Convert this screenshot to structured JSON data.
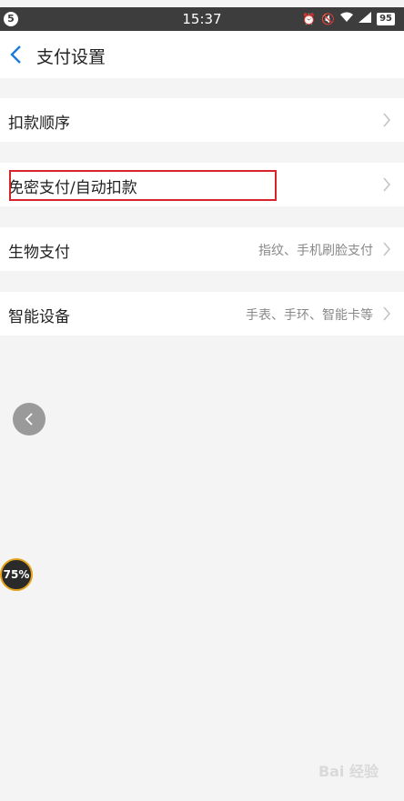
{
  "status_bar": {
    "notification_count": "5",
    "time": "15:37",
    "battery": "95"
  },
  "header": {
    "title": "支付设置"
  },
  "rows": [
    {
      "label": "扣款顺序",
      "value": ""
    },
    {
      "label": "免密支付/自动扣款",
      "value": ""
    },
    {
      "label": "生物支付",
      "value": "指纹、手机刷脸支付"
    },
    {
      "label": "智能设备",
      "value": "手表、手环、智能卡等"
    }
  ],
  "overlays": {
    "speed_ball": "75%",
    "watermark": "Bai 经验"
  },
  "colors": {
    "highlight": "#d9232b",
    "accent": "#1a7bd9"
  }
}
